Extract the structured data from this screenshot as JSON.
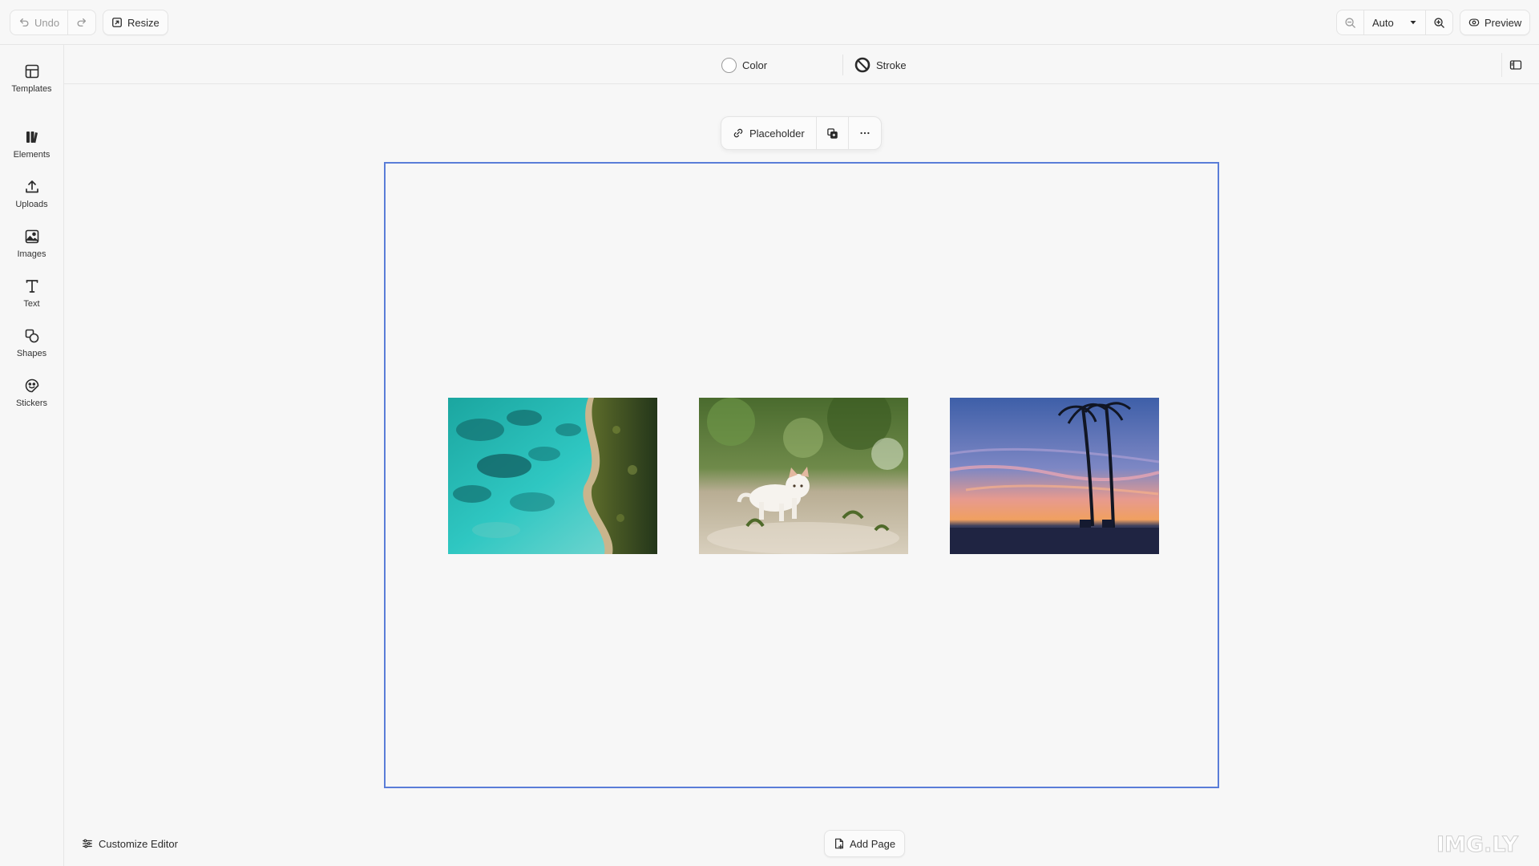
{
  "topbar": {
    "undo_label": "Undo",
    "resize_label": "Resize",
    "zoom_value": "Auto",
    "preview_label": "Preview"
  },
  "sidebar": {
    "items": [
      {
        "label": "Templates",
        "icon": "templates-icon"
      },
      {
        "label": "Elements",
        "icon": "elements-icon"
      },
      {
        "label": "Uploads",
        "icon": "upload-icon"
      },
      {
        "label": "Images",
        "icon": "image-icon"
      },
      {
        "label": "Text",
        "icon": "text-icon"
      },
      {
        "label": "Shapes",
        "icon": "shapes-icon"
      },
      {
        "label": "Stickers",
        "icon": "sticker-icon"
      }
    ]
  },
  "properties": {
    "color_label": "Color",
    "stroke_label": "Stroke",
    "fill_color": "#ffffff"
  },
  "selection_toolbar": {
    "placeholder_label": "Placeholder"
  },
  "canvas": {
    "selection_color": "#5a7dd8",
    "photos": [
      {
        "name": "aerial-coast-photo"
      },
      {
        "name": "white-kitten-photo"
      },
      {
        "name": "palm-sunset-photo"
      }
    ]
  },
  "footer": {
    "customize_label": "Customize Editor",
    "add_page_label": "Add Page",
    "brand": "IMG.LY"
  }
}
